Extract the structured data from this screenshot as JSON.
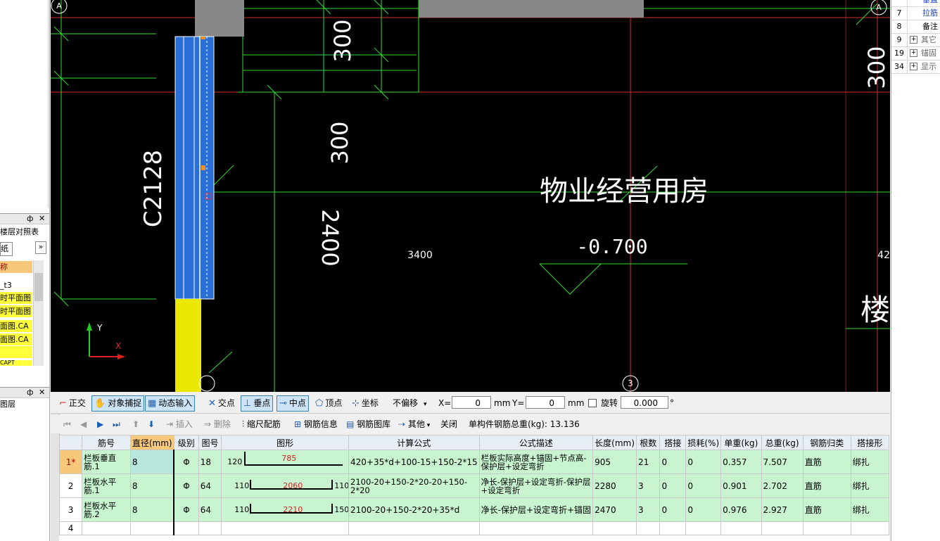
{
  "left_panel": {
    "pane1_title_pin": "ф",
    "pane1_title_close": "✕",
    "floor_tab": "楼层对照表",
    "drawing_tab": "纸",
    "expand": "»",
    "header": "称",
    "items": [
      "_t3",
      "时平面图",
      "时平面图",
      "面图.CA",
      "面图.CA",
      "",
      "CAPT"
    ],
    "pane2_title_pin": "ф",
    "pane2_title_close": "✕",
    "pane2_item": "图层"
  },
  "right_panel": {
    "rows": [
      {
        "num": "",
        "label": "垂直"
      },
      {
        "num": "7",
        "label": "拉筋"
      },
      {
        "num": "8",
        "label": "备注"
      },
      {
        "num": "9",
        "label": "其它"
      },
      {
        "num": "19",
        "label": "锚固"
      },
      {
        "num": "34",
        "label": "显示"
      }
    ]
  },
  "cad": {
    "room_name": "物业经营用房",
    "elevation": "-0.700",
    "dim_300_a": "300",
    "dim_300_b": "300",
    "dim_300_c": "300",
    "dim_2400": "2400",
    "dim_3400": "3400",
    "window_tag": "C2128",
    "axis_a_left": "A",
    "axis_a_right": "A",
    "axis_3": "3",
    "stair_partial": "楼",
    "dim_partial": "42",
    "ucs_y": "Y",
    "ucs_x": "X"
  },
  "snap_toolbar": {
    "ortho": "正交",
    "osnap": "对象捕捉",
    "dynamic_input": "动态输入",
    "intersection": "交点",
    "perpendicular": "垂点",
    "midpoint": "中点",
    "vertex": "顶点",
    "coordinate": "坐标",
    "offset_mode": "不偏移",
    "x_label": "X=",
    "x_value": "0",
    "x_unit": "mm",
    "y_label": "Y=",
    "y_value": "0",
    "y_unit": "mm",
    "rotate_label": "旋转",
    "rotate_value": "0.000",
    "rotate_unit": "°"
  },
  "rebar_toolbar": {
    "insert": "插入",
    "delete": "删除",
    "scale_rebar": "缩尺配筋",
    "rebar_info": "钢筋信息",
    "rebar_library": "钢筋图库",
    "other": "其他",
    "close": "关闭",
    "total_weight": "单构件钢筋总重(kg): 13.136"
  },
  "table": {
    "headers": [
      "",
      "筋号",
      "直径(mm)",
      "级别",
      "图号",
      "图形",
      "计算公式",
      "公式描述",
      "长度(mm)",
      "根数",
      "搭接",
      "损耗(%)",
      "单重(kg)",
      "总重(kg)",
      "钢筋归类",
      "搭接形"
    ],
    "rows": [
      {
        "idx": "1*",
        "name": "栏板垂直筋.1",
        "dia": "8",
        "grade": "Φ",
        "fig": "18",
        "shape_left": "120",
        "shape_mid": "785",
        "shape_right": "",
        "formula": "420+35*d+100-15+150-2*15",
        "desc": "栏板实际高度+锚固+节点高-保护层+设定弯折",
        "length": "905",
        "count": "21",
        "lap": "0",
        "loss": "0",
        "unit_w": "0.357",
        "total_w": "7.507",
        "category": "直筋",
        "lap_type": "绑扎"
      },
      {
        "idx": "2",
        "name": "栏板水平筋.1",
        "dia": "8",
        "grade": "Φ",
        "fig": "64",
        "shape_left": "110",
        "shape_mid": "2060",
        "shape_right": "110",
        "formula": "2100-20+150-2*20-20+150-2*20",
        "desc": "净长-保护层+设定弯折-保护层+设定弯折",
        "length": "2280",
        "count": "3",
        "lap": "0",
        "loss": "0",
        "unit_w": "0.901",
        "total_w": "2.702",
        "category": "直筋",
        "lap_type": "绑扎"
      },
      {
        "idx": "3",
        "name": "栏板水平筋.2",
        "dia": "8",
        "grade": "Φ",
        "fig": "64",
        "shape_left": "110",
        "shape_mid": "2210",
        "shape_right": "150",
        "formula": "2100-20+150-2*20+35*d",
        "desc": "净长-保护层+设定弯折+锚固",
        "length": "2470",
        "count": "3",
        "lap": "0",
        "loss": "0",
        "unit_w": "0.976",
        "total_w": "2.927",
        "category": "直筋",
        "lap_type": "绑扎"
      },
      {
        "idx": "4"
      }
    ]
  }
}
